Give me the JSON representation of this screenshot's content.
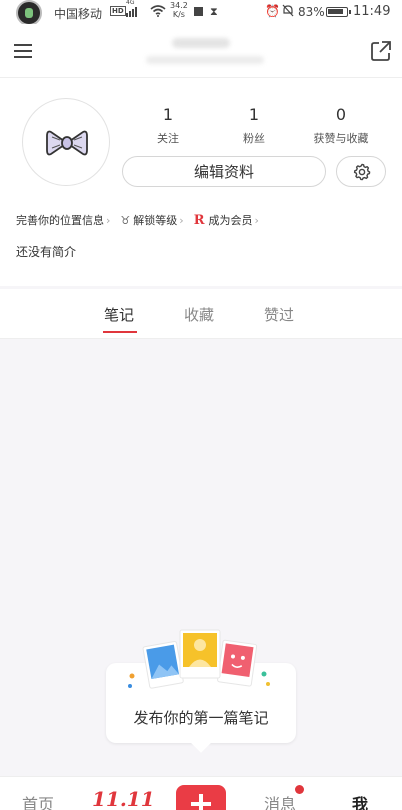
{
  "status_bar": {
    "carrier": "中国移动",
    "hd": "HD",
    "network": "4G",
    "speed_value": "34.2",
    "speed_unit": "K/s",
    "battery": "83%",
    "time": "11:49"
  },
  "stats": [
    {
      "value": "1",
      "label": "关注"
    },
    {
      "value": "1",
      "label": "粉丝"
    },
    {
      "value": "0",
      "label": "获赞与收藏"
    }
  ],
  "profile": {
    "edit_label": "编辑资料",
    "bio": "还没有简介"
  },
  "links": {
    "location": "完善你的位置信息",
    "level": "解锁等级",
    "member": "成为会员"
  },
  "tabs": [
    {
      "label": "笔记",
      "active": true
    },
    {
      "label": "收藏",
      "active": false
    },
    {
      "label": "赞过",
      "active": false
    }
  ],
  "empty_state": {
    "text": "发布你的第一篇笔记"
  },
  "bottom_nav": {
    "home": "首页",
    "promo": "11.11",
    "messages": "消息",
    "me": "我"
  },
  "colors": {
    "accent": "#e0363c",
    "background": "#f6f5f8"
  }
}
